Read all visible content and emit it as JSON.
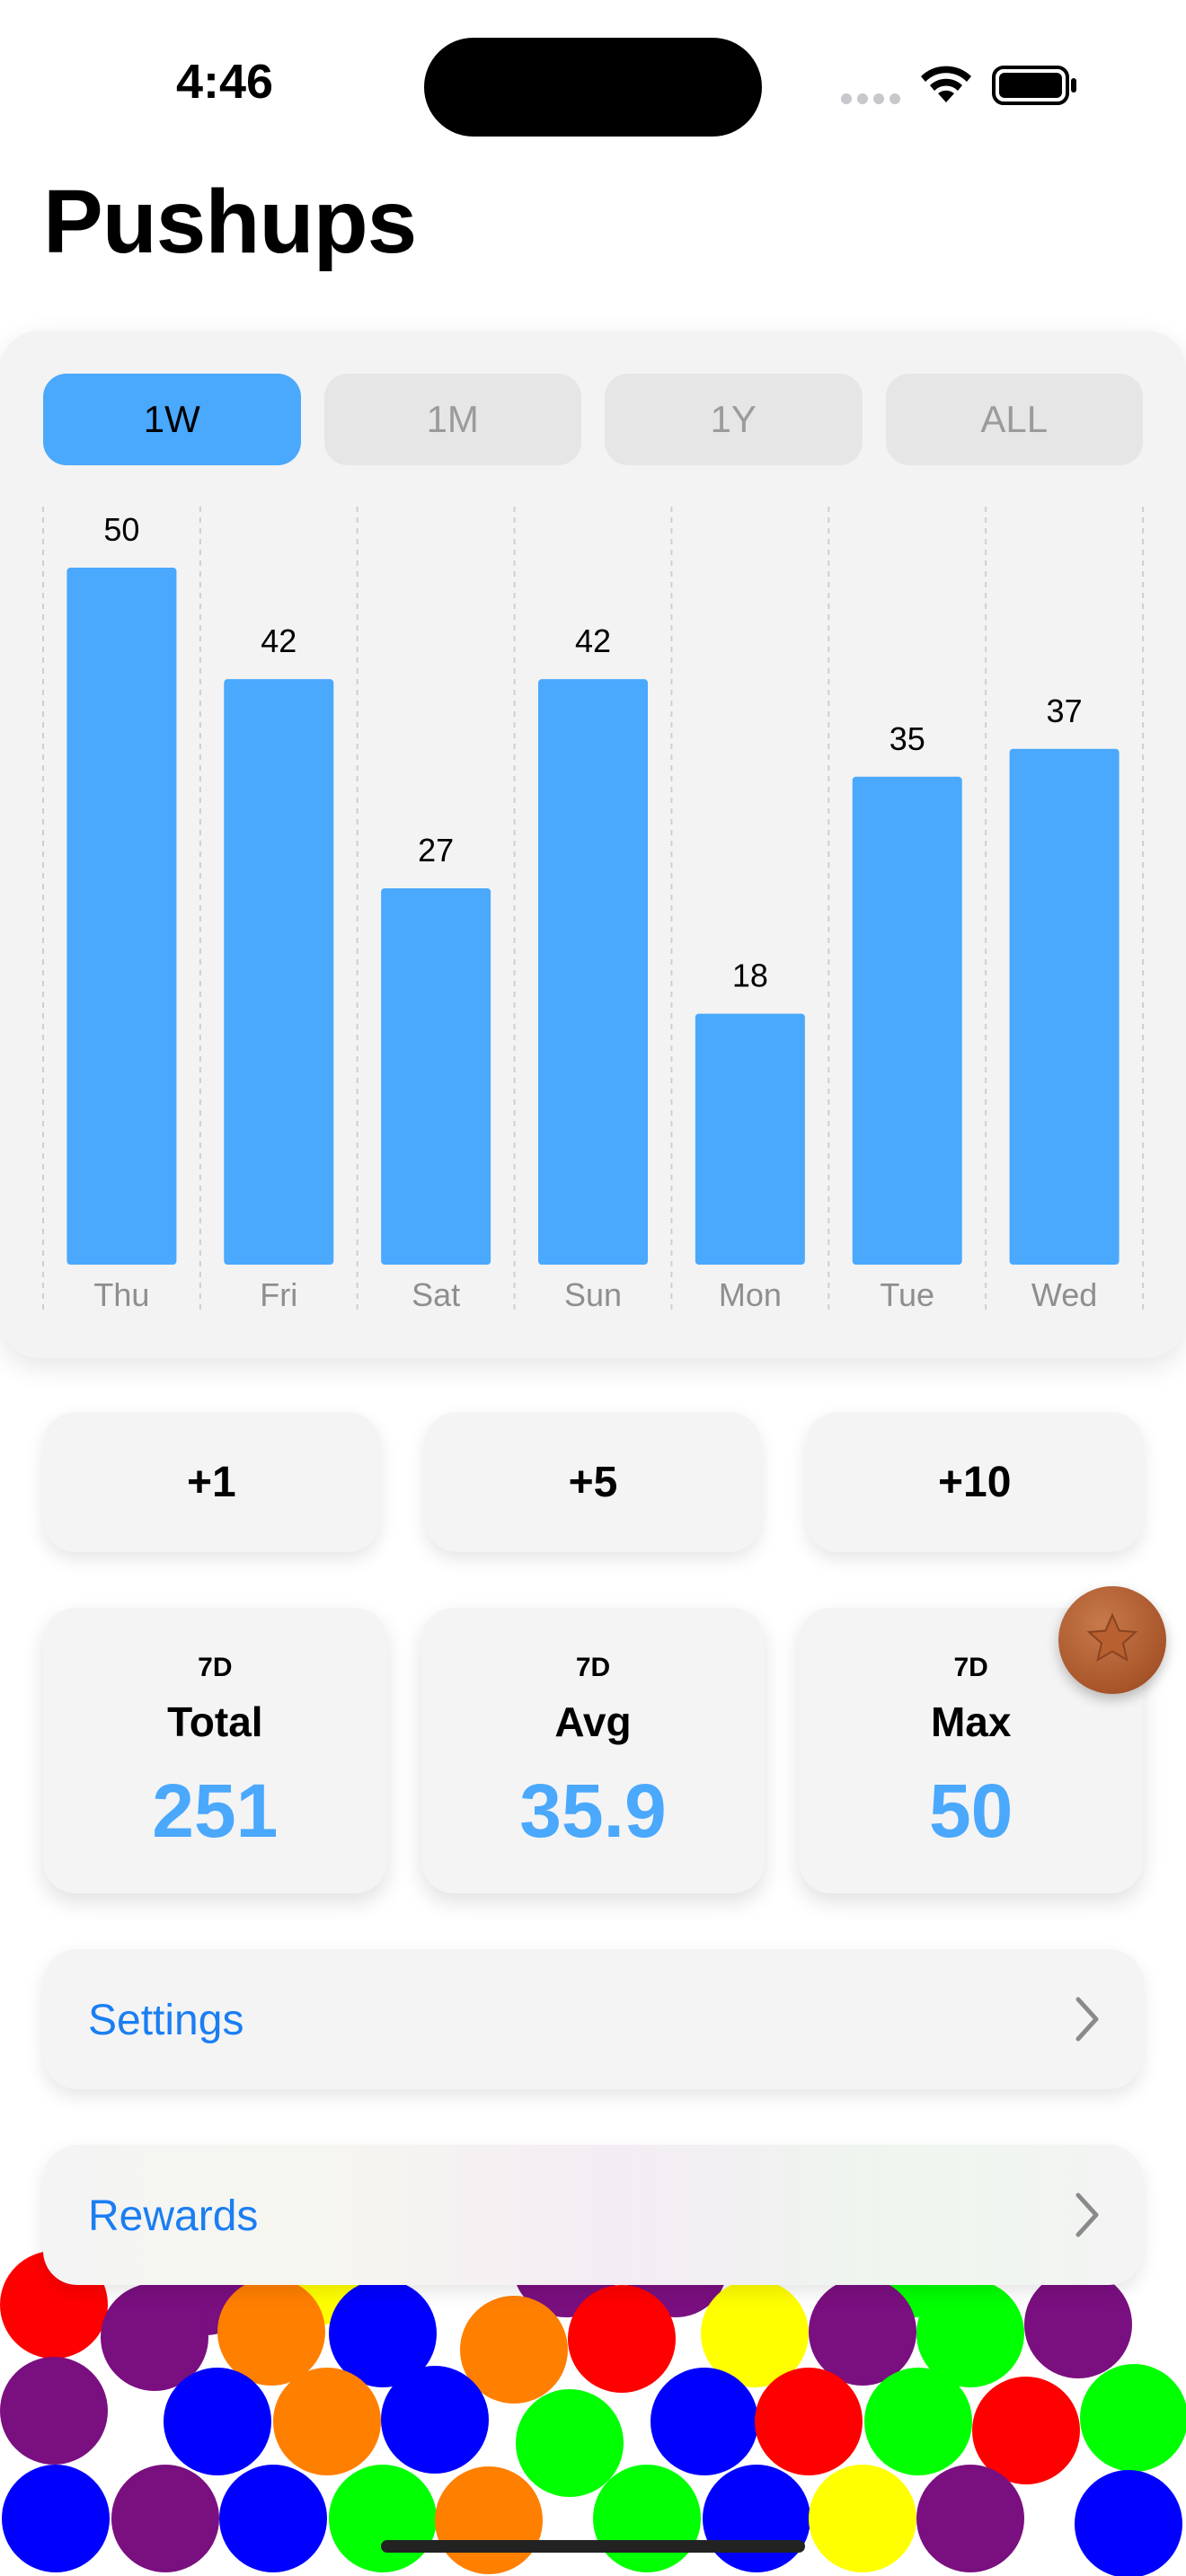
{
  "status": {
    "time": "4:46"
  },
  "page": {
    "title": "Pushups"
  },
  "range_tabs": [
    {
      "label": "1W",
      "active": true
    },
    {
      "label": "1M",
      "active": false
    },
    {
      "label": "1Y",
      "active": false
    },
    {
      "label": "ALL",
      "active": false
    }
  ],
  "chart_data": {
    "type": "bar",
    "categories": [
      "Thu",
      "Fri",
      "Sat",
      "Sun",
      "Mon",
      "Tue",
      "Wed"
    ],
    "values": [
      50,
      42,
      27,
      42,
      18,
      35,
      37
    ],
    "ylim": [
      0,
      50
    ],
    "grid": "vertical dashed",
    "bar_color": "#4aa8fd",
    "data_labels": true
  },
  "add_buttons": [
    "+1",
    "+5",
    "+10"
  ],
  "stats": [
    {
      "period": "7D",
      "label": "Total",
      "value": "251"
    },
    {
      "period": "7D",
      "label": "Avg",
      "value": "35.9"
    },
    {
      "period": "7D",
      "label": "Max",
      "value": "50"
    }
  ],
  "nav": {
    "settings": "Settings",
    "rewards": "Rewards"
  },
  "colors": {
    "accent": "#4aa8fd",
    "link": "#1a7ef2",
    "badge": "#a8552a"
  },
  "icons": {
    "wifi": "wifi-icon",
    "battery": "battery-icon",
    "badge": "bronze-star-badge-icon",
    "chevron": "chevron-right-icon"
  }
}
